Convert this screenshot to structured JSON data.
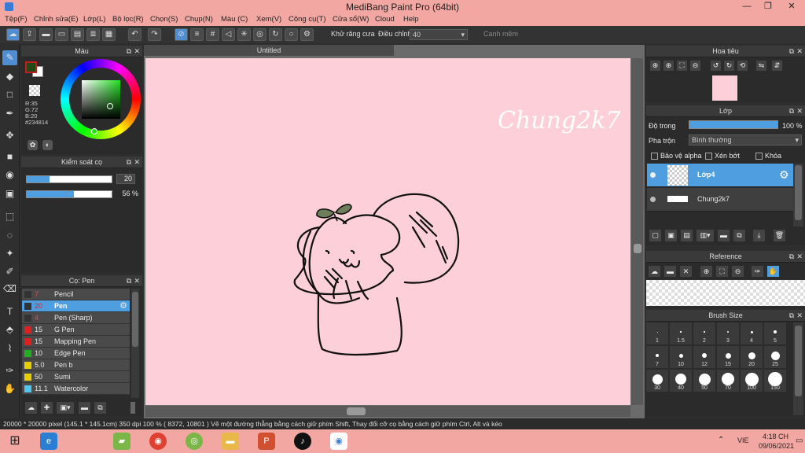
{
  "window": {
    "title": "MediBang Paint Pro (64bit)"
  },
  "menu": [
    "Tệp(F)",
    "Chỉnh sửa(E)",
    "Lớp(L)",
    "Bộ lọc(R)",
    "Chọn(S)",
    "Chụp(N)",
    "Màu (C)",
    "Xem(V)",
    "Công cụ(T)",
    "Cửa sổ(W)",
    "Cloud",
    "Help"
  ],
  "toolbar": {
    "antialias_label": "Khử răng cưa",
    "adjust_label": "Điều chỉnh",
    "adjust_value": "40",
    "snap_label": "Canh mềm"
  },
  "color_panel": {
    "title": "Màu",
    "r": "R:35",
    "g": "G:72",
    "b": "B:20",
    "hex": "#234814",
    "fg": "#234814",
    "accent": "#4f9ee0"
  },
  "brush_control": {
    "title": "Kiểm soát cọ",
    "size": "20",
    "opacity": "56 %",
    "size_fraction": 0.27,
    "opacity_fraction": 0.56
  },
  "brush_panel": {
    "title": "Cọ: Pen",
    "items": [
      {
        "size": "7",
        "name": "Pencil",
        "color": "#333333"
      },
      {
        "size": "20",
        "name": "Pen",
        "color": "#333333"
      },
      {
        "size": "4",
        "name": "Pen (Sharp)",
        "color": "#333333"
      },
      {
        "size": "15",
        "name": "G Pen",
        "color": "#e02020"
      },
      {
        "size": "15",
        "name": "Mapping Pen",
        "color": "#e02020"
      },
      {
        "size": "10",
        "name": "Edge Pen",
        "color": "#20b020"
      },
      {
        "size": "5.0",
        "name": "Pen b",
        "color": "#e8d000"
      },
      {
        "size": "50",
        "name": "Sumi",
        "color": "#e8d000"
      },
      {
        "size": "11.1",
        "name": "Watercolor",
        "color": "#4fc8f0"
      }
    ]
  },
  "document": {
    "tab": "Untitled",
    "signature": "Chung2k7"
  },
  "navigator": {
    "title": "Hoa tiêu"
  },
  "layers": {
    "title": "Lớp",
    "opacity_label": "Độ trong",
    "opacity_value": "100 %",
    "blend_label": "Pha trộn",
    "blend_value": "Bình thường",
    "protect_alpha": "Bảo vệ alpha",
    "clipping": "Xén bớt",
    "lock": "Khóa",
    "items": [
      {
        "name": "Lớp4"
      },
      {
        "name": "Chung2k7"
      }
    ]
  },
  "reference": {
    "title": "Reference"
  },
  "brush_size": {
    "title": "Brush Size",
    "sizes": [
      "1",
      "1.5",
      "2",
      "3",
      "4",
      "5",
      "7",
      "10",
      "12",
      "15",
      "20",
      "25",
      "30",
      "40",
      "50",
      "70",
      "100",
      "150"
    ]
  },
  "status": {
    "text": "20000 * 20000 pixel   (145.1 * 145.1cm)   350 dpi   100 %   ( 8372, 10801 )   Vẽ một đường thẳng bằng cách giữ phím Shift, Thay đổi cỡ cọ bằng cách giữ phím Ctrl, Alt và kéo"
  },
  "taskbar": {
    "lang": "VIE",
    "time": "4:18 CH",
    "date": "09/06/2021"
  }
}
